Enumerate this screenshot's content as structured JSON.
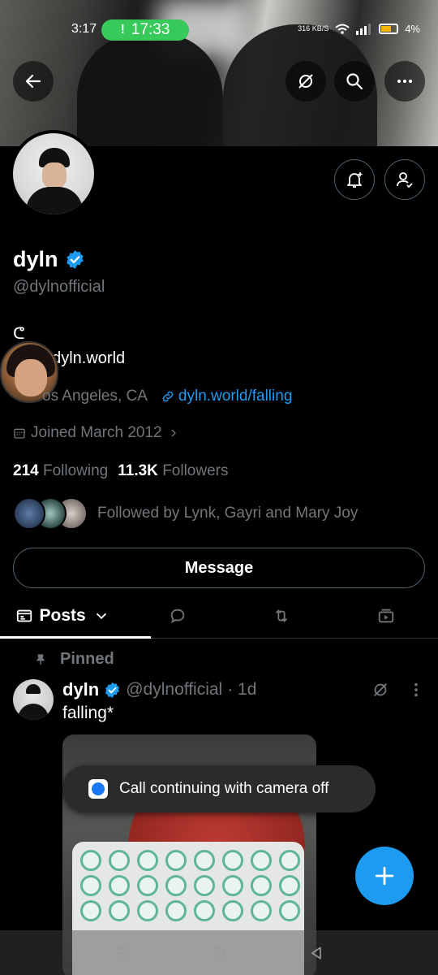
{
  "status_bar": {
    "time": "3:17",
    "call_timer": "17:33",
    "call_icon": "!",
    "net_speed": "316 KB/S",
    "battery_pct": "4%"
  },
  "header_buttons": {
    "back": "back-arrow-icon",
    "media_off": "media-off-icon",
    "search": "search-icon",
    "more": "more-icon"
  },
  "profile": {
    "name": "dyln",
    "handle": "@dylnofficial",
    "bio_symbol": "ᕦ",
    "bio_line": "t@dyln.world",
    "location": "os Angeles, CA",
    "website": "dyln.world/falling",
    "joined": "Joined March 2012",
    "following_count": "214",
    "following_label": "Following",
    "followers_count": "11.3K",
    "followers_label": "Followers",
    "followed_by": "Followed by Lynk, Gayri and Mary Joy",
    "message_label": "Message"
  },
  "tabs": [
    {
      "label": "Posts",
      "icon": "posts-icon"
    },
    {
      "label": "",
      "icon": "reply-icon"
    },
    {
      "label": "",
      "icon": "repost-icon"
    },
    {
      "label": "",
      "icon": "media-icon"
    }
  ],
  "post": {
    "pinned_label": "Pinned",
    "author": "dyln",
    "handle": "@dylnofficial",
    "time": "· 1d",
    "text": "falling*"
  },
  "toast": {
    "text": "Call continuing with camera off"
  },
  "colors": {
    "accent": "#1d9bf0",
    "call_green": "#37c95a",
    "muted": "#71767b"
  }
}
